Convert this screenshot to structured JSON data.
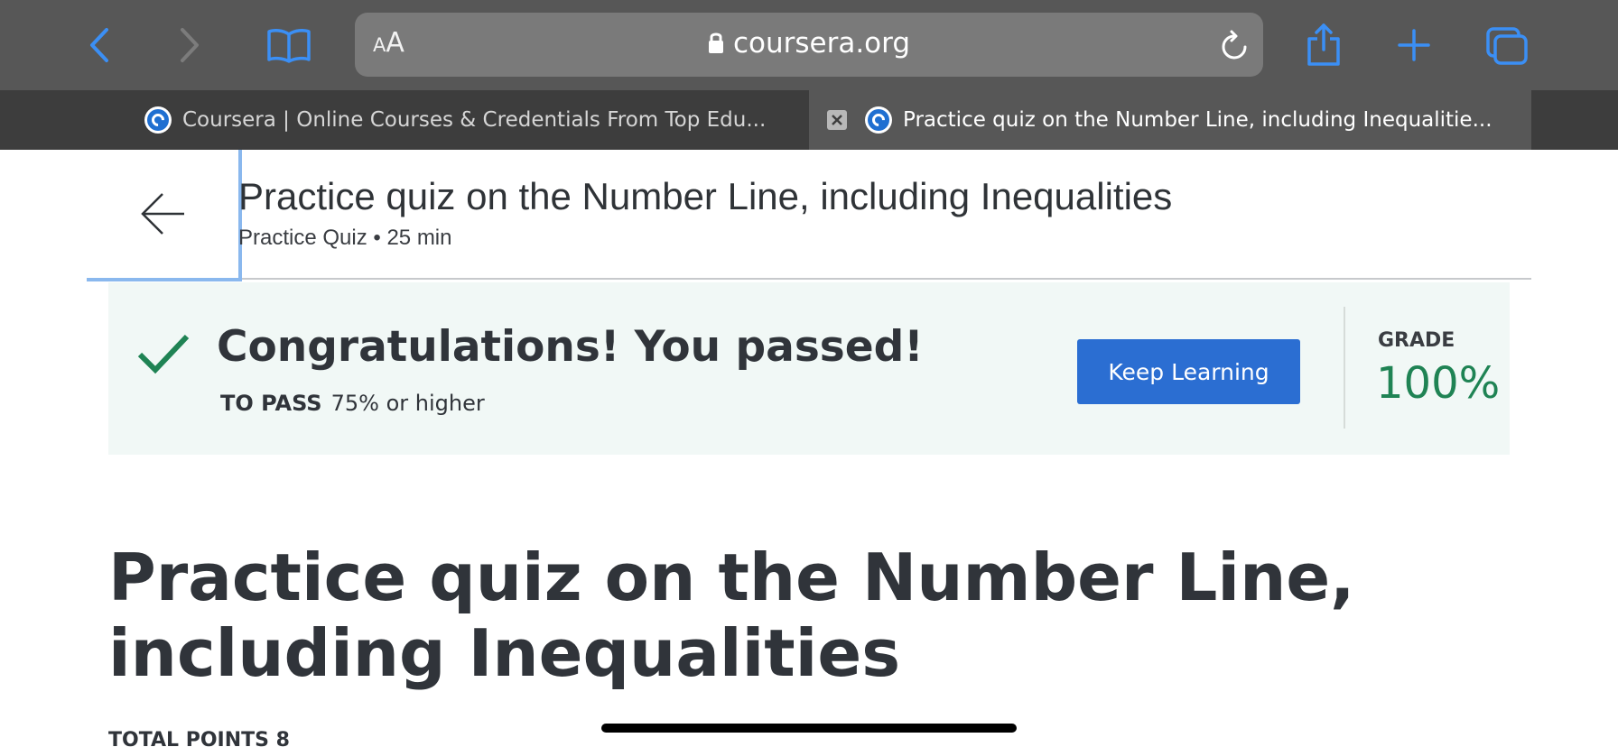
{
  "browser": {
    "address_small": "A",
    "address_big": "A",
    "url": "coursera.org",
    "accent_color": "#3b8ff5",
    "icons": [
      "back-icon",
      "forward-icon",
      "bookmarks-icon",
      "lock-icon",
      "reload-icon",
      "share-icon",
      "new-tab-icon",
      "tabs-overview-icon"
    ]
  },
  "tabs": [
    {
      "title": "Coursera | Online Courses & Credentials From Top Edu...",
      "active": false
    },
    {
      "title": "Practice quiz on the Number Line, including Inequalitie...",
      "active": true
    }
  ],
  "header": {
    "title": "Practice quiz on the Number Line, including Inequalities",
    "meta": "Practice Quiz • 25 min"
  },
  "result": {
    "message": "Congratulations! You passed!",
    "to_pass_label": "TO PASS",
    "to_pass_value": "75% or higher",
    "button_label": "Keep Learning",
    "grade_label": "GRADE",
    "grade_value": "100%",
    "pass_color": "#1f8354",
    "button_color": "#2b6ed2"
  },
  "quiz": {
    "title": "Practice quiz on the Number Line, including Inequalities",
    "total_points": "TOTAL POINTS 8"
  }
}
